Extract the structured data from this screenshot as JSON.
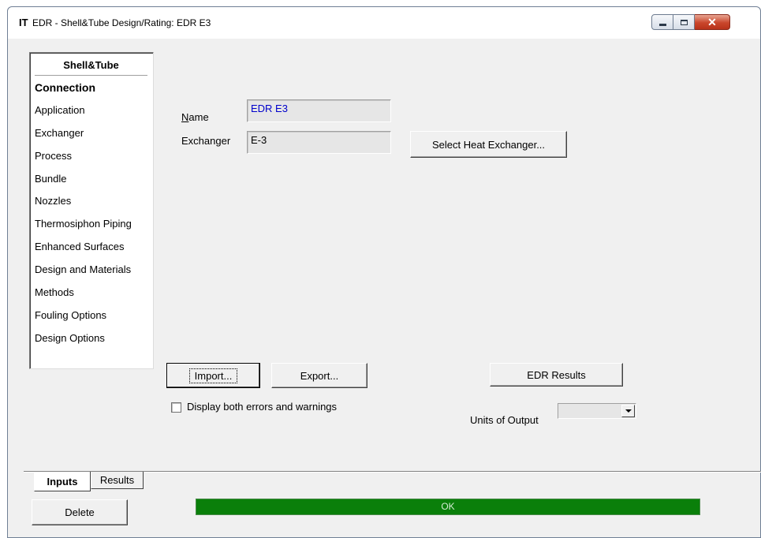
{
  "window": {
    "app_icon": "IT",
    "title": "EDR - Shell&Tube Design/Rating: EDR E3",
    "minimize_icon": "minimize-icon",
    "maximize_icon": "maximize-icon",
    "close_icon": "close-icon"
  },
  "nav": {
    "header": "Shell&Tube",
    "items": [
      {
        "label": "Connection",
        "active": true
      },
      {
        "label": "Application"
      },
      {
        "label": "Exchanger"
      },
      {
        "label": "Process"
      },
      {
        "label": "Bundle"
      },
      {
        "label": "Nozzles"
      },
      {
        "label": "Thermosiphon Piping"
      },
      {
        "label": "Enhanced Surfaces"
      },
      {
        "label": "Design and Materials"
      },
      {
        "label": "Methods"
      },
      {
        "label": "Fouling Options"
      },
      {
        "label": "Design Options"
      }
    ]
  },
  "form": {
    "name_label_mnemonic": "N",
    "name_label_rest": "ame",
    "name_value": "EDR E3",
    "exchanger_label": "Exchanger",
    "exchanger_value": "E-3",
    "select_button": "Select Heat Exchanger..."
  },
  "actions": {
    "import_button": "Import...",
    "export_button": "Export...",
    "results_button": "EDR Results",
    "display_checkbox_label": "Display both errors and warnings",
    "display_checkbox_checked": false,
    "units_label": "Units of Output",
    "units_value": ""
  },
  "tabs": [
    {
      "label": "Inputs",
      "active": true
    },
    {
      "label": "Results"
    }
  ],
  "footer": {
    "delete_button": "Delete",
    "status_text": "OK",
    "status_color": "#0a7f0a"
  },
  "colors": {
    "name_value_color": "#0000cc"
  }
}
